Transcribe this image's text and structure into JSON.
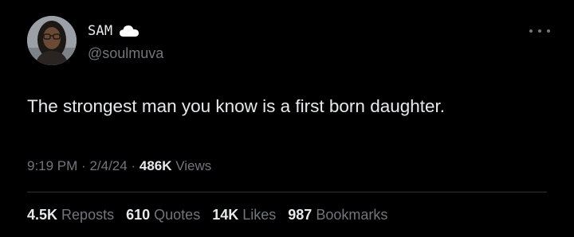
{
  "author": {
    "display_name": "SAM",
    "handle": "@soulmuva",
    "badge_icon": "cloud-icon"
  },
  "tweet": {
    "text": "The strongest man you know is a first born daughter."
  },
  "meta": {
    "time": "9:19 PM",
    "separator": "·",
    "date": "2/4/24",
    "views_count": "486K",
    "views_label": "Views"
  },
  "stats": [
    {
      "count": "4.5K",
      "label": "Reposts"
    },
    {
      "count": "610",
      "label": "Quotes"
    },
    {
      "count": "14K",
      "label": "Likes"
    },
    {
      "count": "987",
      "label": "Bookmarks"
    }
  ],
  "colors": {
    "background": "#000000",
    "primary_text": "#e7e9ea",
    "secondary_text": "#71767b",
    "divider": "#2f3336"
  },
  "icons": {
    "more": "more-horizontal-icon"
  }
}
